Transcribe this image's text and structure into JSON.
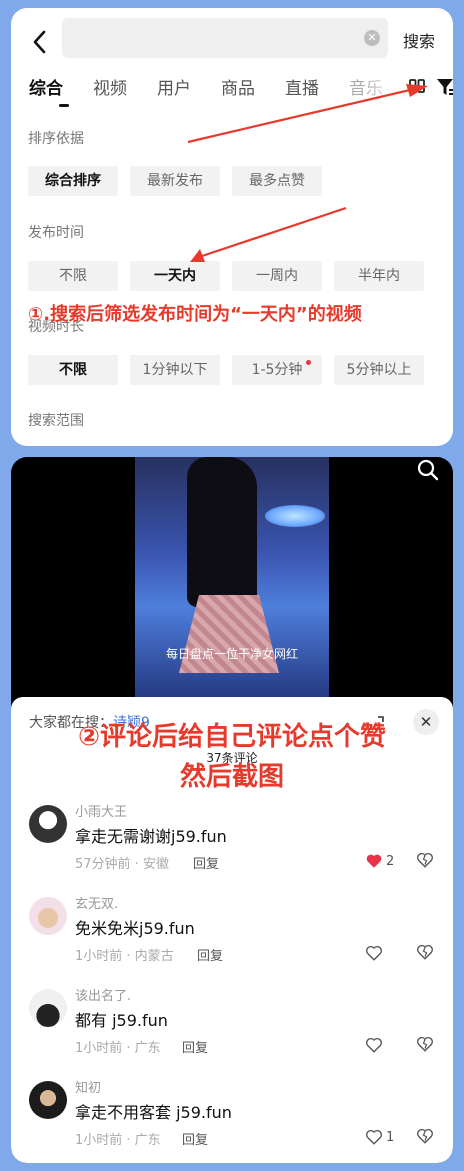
{
  "search": {
    "placeholder": "",
    "submit_label": "搜索",
    "clear_icon": "clear-icon"
  },
  "tabs": [
    "综合",
    "视频",
    "用户",
    "商品",
    "直播",
    "音乐"
  ],
  "active_tab": "综合",
  "filters": {
    "sort_label": "排序依据",
    "sort_options": [
      "综合排序",
      "最新发布",
      "最多点赞"
    ],
    "sort_selected": "综合排序",
    "time_label": "发布时间",
    "time_options": [
      "不限",
      "一天内",
      "一周内",
      "半年内"
    ],
    "time_selected": "一天内",
    "duration_label": "视频时长",
    "duration_options": [
      "不限",
      "1分钟以下",
      "1-5分钟",
      "5分钟以上"
    ],
    "duration_selected": "不限",
    "scope_label": "搜索范围"
  },
  "annotation_1": "①.搜索后筛选发布时间为“一天内”的视频",
  "video": {
    "caption": "每日盘点一位干净女网红"
  },
  "comments_sheet": {
    "everyone_search_prefix": "大家都在搜：",
    "everyone_search_term": "诗颖9",
    "count_label": "37条评论",
    "annotation_2_line1": "②评论后给自己评论点个赞",
    "annotation_2_line2": "然后截图",
    "reply_label": "回复",
    "comments": [
      {
        "user": "小雨大王",
        "text": "拿走无需谢谢j59.fun",
        "meta": "57分钟前 · 安徽",
        "likes": "2",
        "liked": true
      },
      {
        "user": "玄无双.",
        "text": "免米免米j59.fun",
        "meta": "1小时前 · 内蒙古",
        "likes": "",
        "liked": false
      },
      {
        "user": "该出名了.",
        "text": "都有  j59.fun",
        "meta": "1小时前 · 广东",
        "likes": "",
        "liked": false
      },
      {
        "user": "知初",
        "text": "拿走不用客套 j59.fun",
        "meta": "1小时前 · 广东",
        "likes": "1",
        "liked": false
      }
    ]
  },
  "colors": {
    "background": "#7fa9ea",
    "annotation_red": "#e63a2c",
    "like_red": "#e8334a",
    "link_blue": "#3d6fd8"
  }
}
